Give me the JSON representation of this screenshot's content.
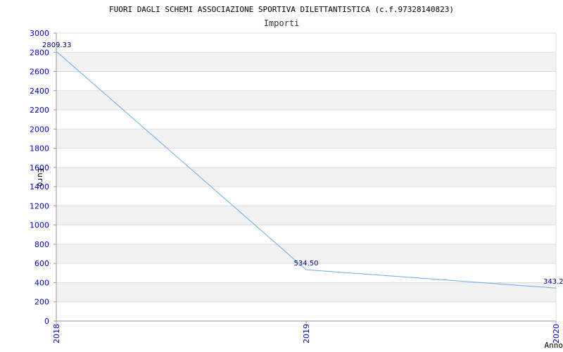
{
  "chart_data": {
    "type": "line",
    "title": "FUORI DAGLI SCHEMI ASSOCIAZIONE SPORTIVA DILETTANTISTICA (c.f.97328140823)",
    "subtitle": "Importi",
    "xlabel": "Anno",
    "ylabel": "Euro",
    "categories": [
      "2018",
      "2019",
      "2020"
    ],
    "series": [
      {
        "values": [
          2809.33,
          534.5,
          343.2
        ],
        "labels": [
          "2809.33",
          "534.50",
          "343.2"
        ],
        "color": "#6aaae8"
      }
    ],
    "ylim": [
      0,
      3000
    ],
    "yticks": [
      0,
      200,
      400,
      600,
      800,
      1000,
      1200,
      1400,
      1600,
      1800,
      2000,
      2200,
      2400,
      2600,
      2800,
      3000
    ],
    "grid": true,
    "band_colors": [
      "#ffffff",
      "#f2f2f2"
    ]
  }
}
